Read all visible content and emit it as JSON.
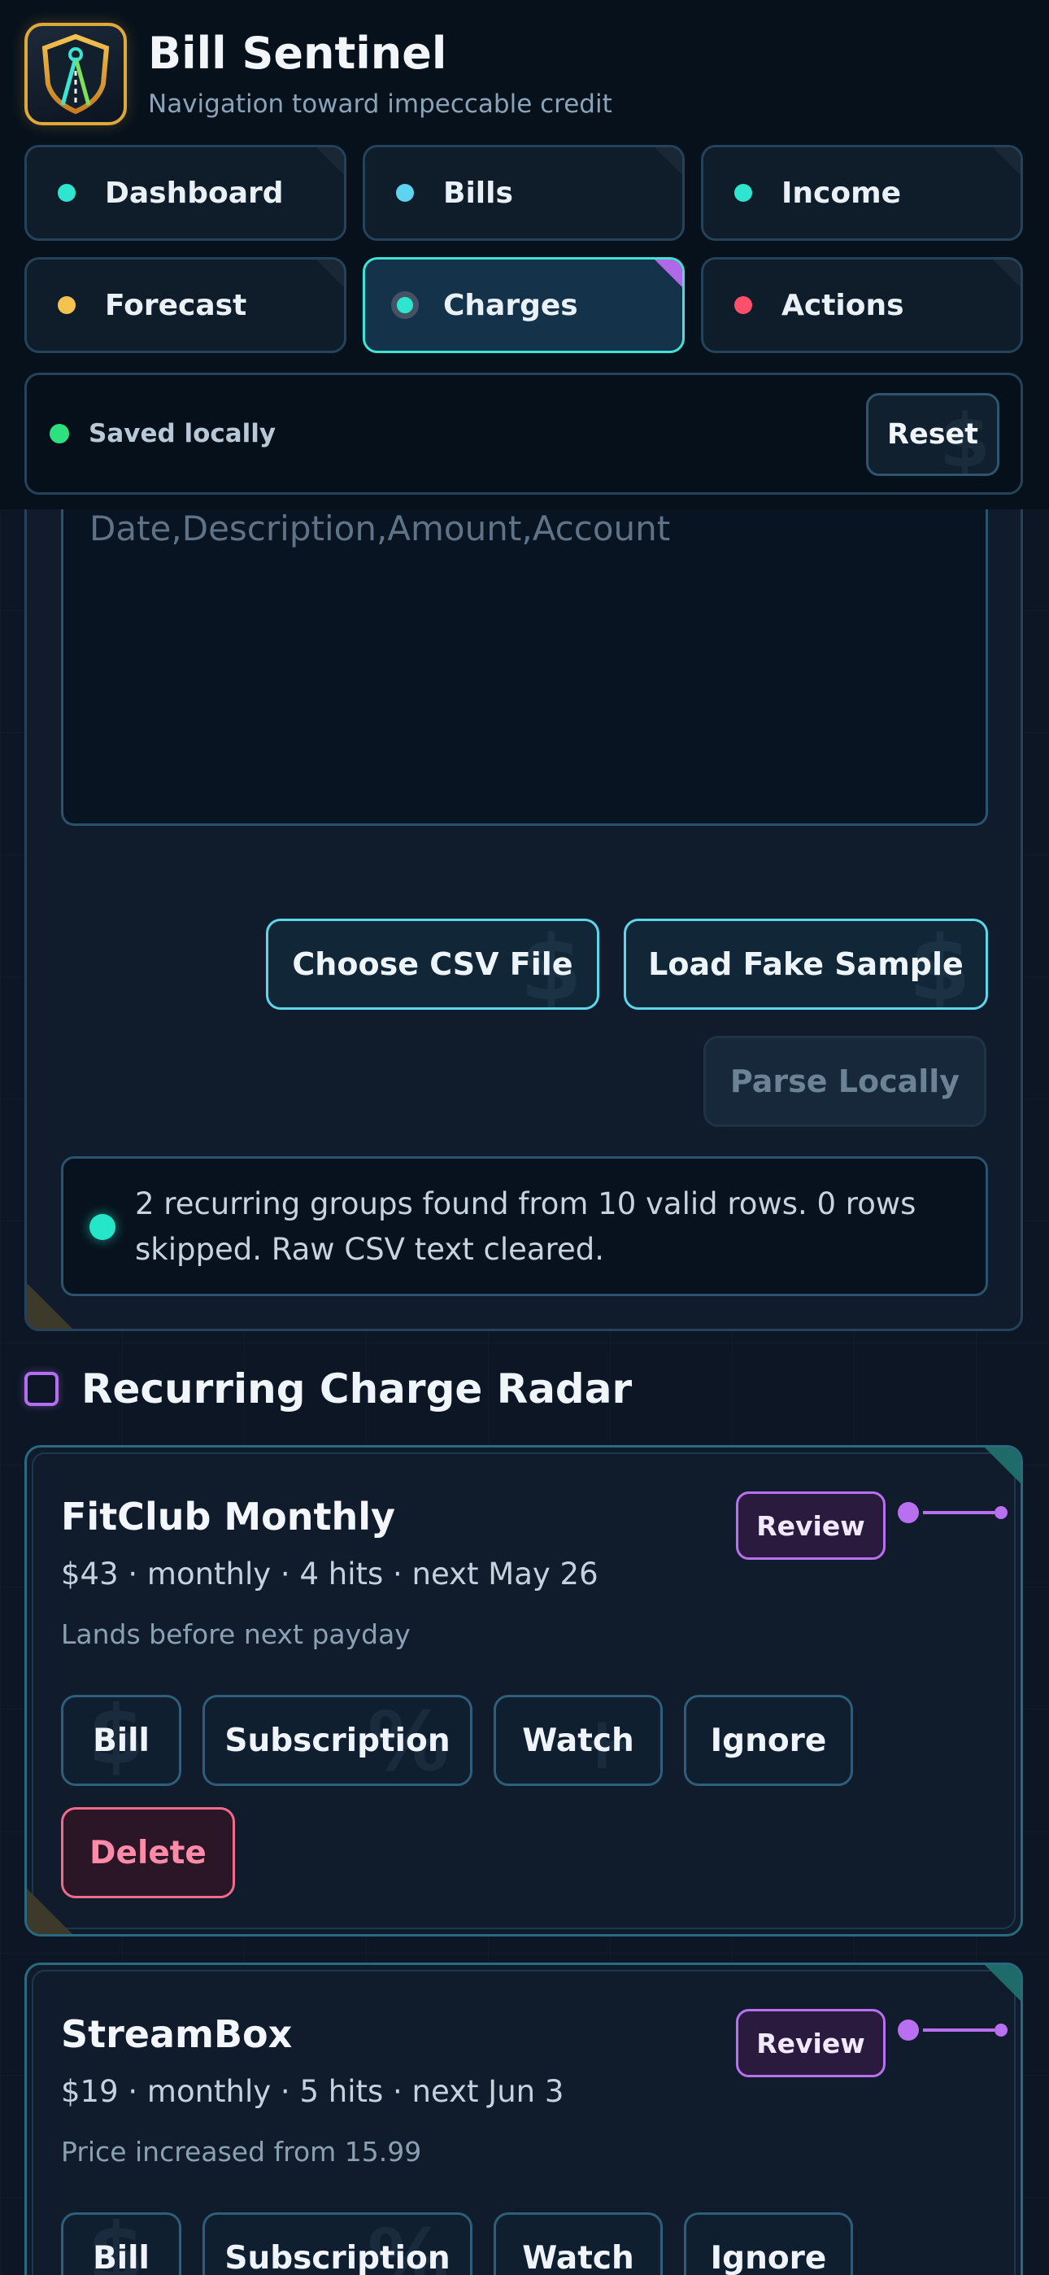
{
  "app": {
    "title": "Bill Sentinel",
    "subtitle": "Navigation toward impeccable credit"
  },
  "nav": [
    {
      "label": "Dashboard",
      "dot_color": "#2ee6cf",
      "active": false
    },
    {
      "label": "Bills",
      "dot_color": "#5fd4f2",
      "active": false
    },
    {
      "label": "Income",
      "dot_color": "#2ee6cf",
      "active": false
    },
    {
      "label": "Forecast",
      "dot_color": "#f4c24f",
      "active": false
    },
    {
      "label": "Charges",
      "dot_color": "#2ee6cf",
      "active": true
    },
    {
      "label": "Actions",
      "dot_color": "#ff4f6b",
      "active": false
    }
  ],
  "status": {
    "text": "Saved locally",
    "reset_label": "Reset"
  },
  "import": {
    "csv_placeholder": "Date,Description,Amount,Account",
    "choose_label": "Choose CSV File",
    "sample_label": "Load Fake Sample",
    "parse_label": "Parse Locally",
    "notice": "2 recurring groups found from 10 valid rows. 0 rows skipped. Raw CSV text cleared."
  },
  "radar": {
    "title": "Recurring Charge Radar",
    "cards": [
      {
        "name": "FitClub Monthly",
        "meta": "$43 · monthly · 4 hits · next May 26",
        "note": "Lands before next payday",
        "badge": "Review"
      },
      {
        "name": "StreamBox",
        "meta": "$19 · monthly · 5 hits · next Jun 3",
        "note": "Price increased from 15.99",
        "badge": "Review"
      }
    ],
    "actions": {
      "bill": "Bill",
      "subscription": "Subscription",
      "watch": "Watch",
      "ignore": "Ignore",
      "delete": "Delete"
    }
  },
  "colors": {
    "accent_teal": "#3fe3d3",
    "accent_purple": "#b870f0",
    "danger": "#f06a8a",
    "gold": "#e0a83a"
  }
}
